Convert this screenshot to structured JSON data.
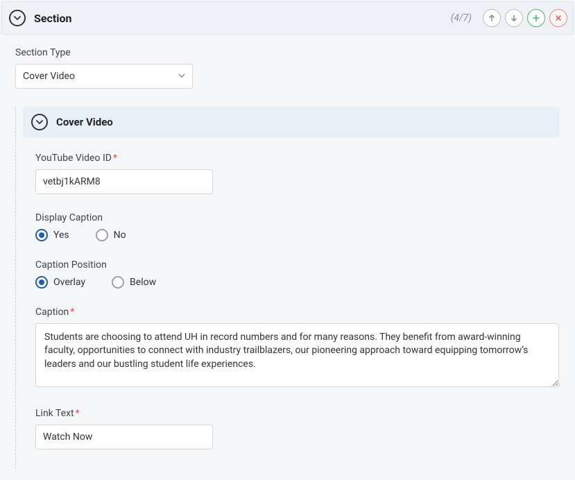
{
  "section": {
    "title": "Section",
    "counter": "(4/7)"
  },
  "sectionType": {
    "label": "Section Type",
    "value": "Cover Video"
  },
  "subsection": {
    "title": "Cover Video"
  },
  "fields": {
    "youtubeId": {
      "label": "YouTube Video ID",
      "required": true,
      "value": "vetbj1kARM8"
    },
    "displayCaption": {
      "label": "Display Caption",
      "options": {
        "yes": "Yes",
        "no": "No"
      },
      "selected": "yes"
    },
    "captionPosition": {
      "label": "Caption Position",
      "options": {
        "overlay": "Overlay",
        "below": "Below"
      },
      "selected": "overlay"
    },
    "caption": {
      "label": "Caption",
      "required": true,
      "value": "Students are choosing to attend UH in record numbers and for many reasons. They benefit from award-winning faculty, opportunities to connect with industry trailblazers, our pioneering approach toward equipping tomorrow’s leaders and our bustling student life experiences."
    },
    "linkText": {
      "label": "Link Text",
      "required": true,
      "value": "Watch Now"
    }
  }
}
